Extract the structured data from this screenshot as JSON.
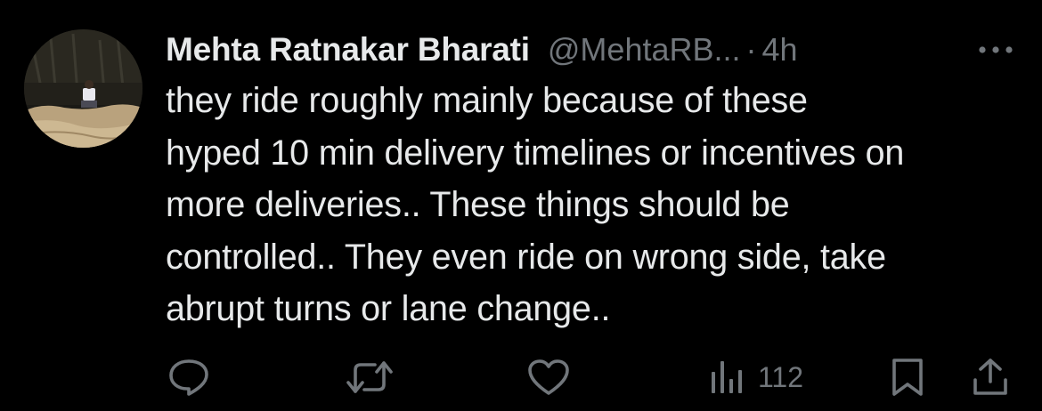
{
  "tweet": {
    "author_name": "Mehta Ratnakar Bharati",
    "handle": "@MehtaRB...",
    "separator": "·",
    "time": "4h",
    "text_lines": [
      "they ride roughly mainly because of these",
      "hyped 10 min delivery timelines or incentives on",
      "more deliveries.. These things should be",
      "controlled.. They even ride on wrong side, take",
      "abrupt turns or lane change.."
    ],
    "actions": {
      "reply_icon": "reply-icon",
      "retweet_icon": "retweet-icon",
      "like_icon": "heart-icon",
      "views_icon": "views-bar-chart-icon",
      "views_count": "112",
      "bookmark_icon": "bookmark-icon",
      "share_icon": "share-icon"
    },
    "more_icon": "more-options-icon"
  },
  "colors": {
    "background": "#000000",
    "primary_text": "#e7e9ea",
    "secondary_text": "#71767b"
  }
}
